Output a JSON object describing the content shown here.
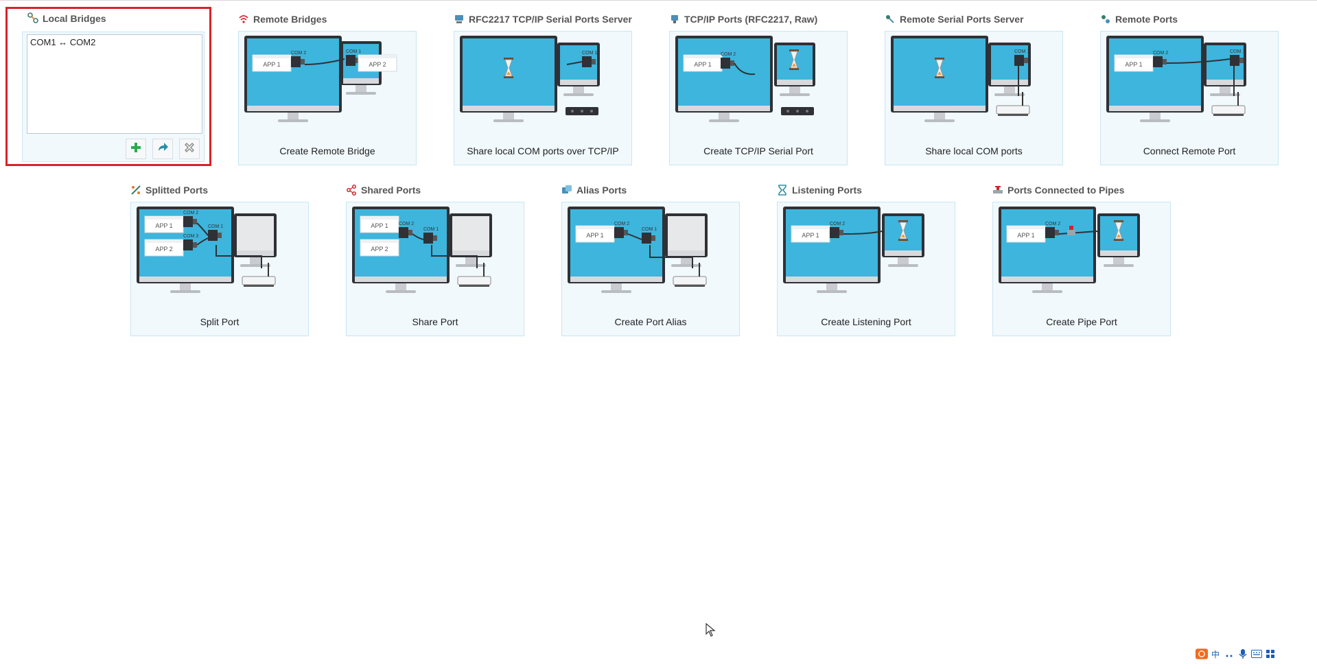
{
  "local_bridges": {
    "title": "Local Bridges",
    "items": [
      "COM1 ↔ COM2"
    ],
    "add_icon": "plus-icon",
    "move_icon": "redo-arrow-icon",
    "remove_icon": "close-x-icon"
  },
  "panels": [
    {
      "title": "Remote Bridges",
      "icon": "wifi-icon",
      "action": "Create Remote Bridge"
    },
    {
      "title": "RFC2217 TCP/IP Serial Ports Server",
      "icon": "server-port-icon",
      "action": "Share local COM ports over TCP/IP"
    },
    {
      "title": "TCP/IP Ports (RFC2217, Raw)",
      "icon": "network-port-icon",
      "action": "Create TCP/IP Serial Port"
    },
    {
      "title": "Remote Serial Ports Server",
      "icon": "remote-server-icon",
      "action": "Share local COM ports"
    },
    {
      "title": "Remote Ports",
      "icon": "remote-port-icon",
      "action": "Connect Remote Port"
    },
    {
      "title": "Splitted Ports",
      "icon": "split-icon",
      "action": "Split Port"
    },
    {
      "title": "Shared Ports",
      "icon": "share-icon",
      "action": "Share Port"
    },
    {
      "title": "Alias Ports",
      "icon": "alias-icon",
      "action": "Create Port Alias"
    },
    {
      "title": "Listening Ports",
      "icon": "hourglass-icon",
      "action": "Create Listening Port"
    },
    {
      "title": "Ports Connected to Pipes",
      "icon": "pipe-valve-icon",
      "action": "Create Pipe Port"
    }
  ],
  "art_labels": {
    "app1": "APP 1",
    "app2": "APP 2",
    "com1": "COM 1",
    "com2": "COM 2",
    "com3": "COM 3"
  },
  "tray": {
    "ime_label": "中",
    "icons": [
      "sogou-ime-icon",
      "ime-chinese-icon",
      "punctuation-icon",
      "microphone-icon",
      "keyboard-icon",
      "settings-grid-icon"
    ]
  },
  "colors": {
    "accent_red": "#d6232b",
    "card_border": "#c9e5f2",
    "card_bg": "#f1f9fd",
    "screen_blue": "#3db5dd",
    "add_green": "#2fa84f",
    "move_teal": "#2a8fa6"
  }
}
